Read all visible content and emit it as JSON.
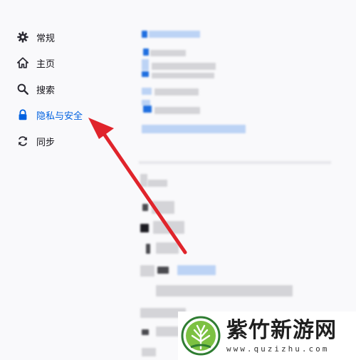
{
  "sidebar": {
    "items": [
      {
        "label": "常规",
        "icon": "gear-icon"
      },
      {
        "label": "主页",
        "icon": "home-icon"
      },
      {
        "label": "搜索",
        "icon": "search-icon"
      },
      {
        "label": "隐私与安全",
        "icon": "lock-icon",
        "active": true
      },
      {
        "label": "同步",
        "icon": "sync-icon"
      }
    ]
  },
  "colors": {
    "accent": "#0061e0",
    "arrow": "#e0242b",
    "background": "#f9f9fb"
  },
  "watermark": {
    "title": "紫竹新游网",
    "url": "www.quzizhu.com"
  }
}
